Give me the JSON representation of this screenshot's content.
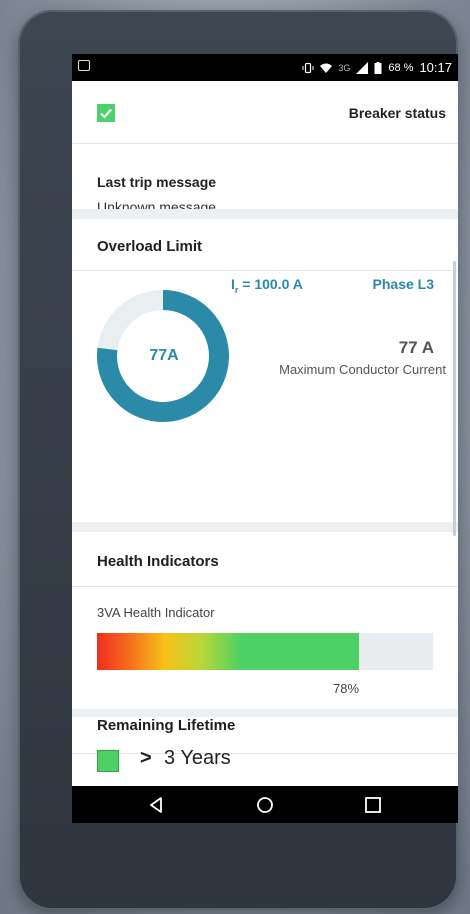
{
  "status_bar": {
    "network": "3G",
    "battery": "68 %",
    "time": "10:17"
  },
  "breaker": {
    "label": "Breaker status",
    "checked": true
  },
  "trip": {
    "title": "Last trip message",
    "value": "Unknown message"
  },
  "overload": {
    "title": "Overload Limit",
    "ir_symbol": "I",
    "ir_subscript": "r",
    "ir_value": "= 100.0 A",
    "phase": "Phase L3",
    "gauge_label": "77A",
    "gauge_fraction": 0.77,
    "current_value": "77 A",
    "current_caption": "Maximum Conductor Current"
  },
  "health": {
    "title": "Health Indicators",
    "indicator_label": "3VA Health Indicator",
    "percent_label": "78%",
    "percent": 78
  },
  "lifetime": {
    "title": "Remaining Lifetime",
    "value": "3 Years",
    "prefix": ">"
  },
  "colors": {
    "accent_teal": "#2a8aa8",
    "gauge_track": "#e9eef1",
    "check_green": "#4cd26b",
    "health_green": "#4ed164",
    "health_yellow": "#f7c21a",
    "health_red": "#ef2d1e",
    "track_gray": "#e9edf0"
  }
}
